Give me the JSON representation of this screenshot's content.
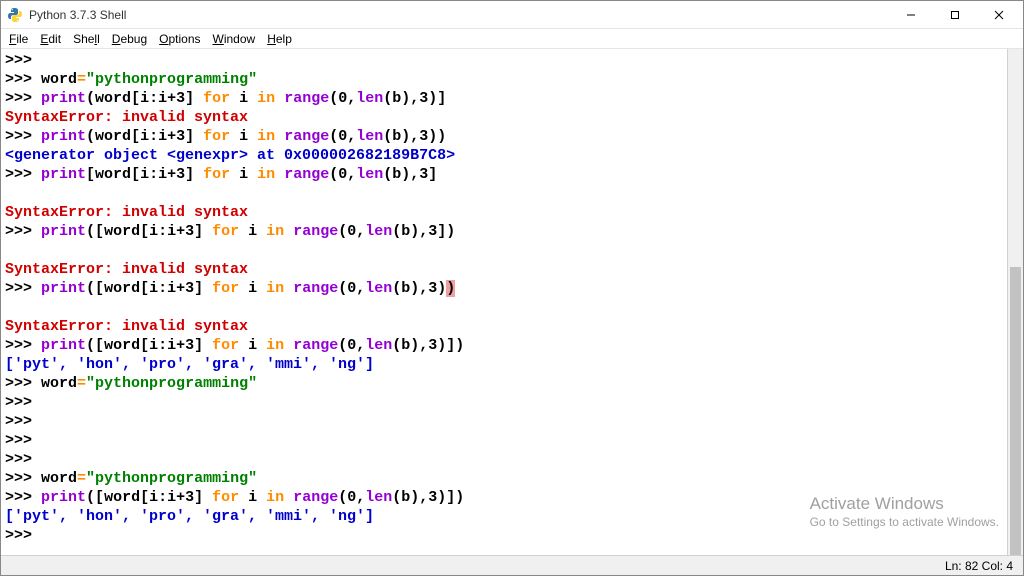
{
  "window": {
    "title": "Python 3.7.3 Shell"
  },
  "menu": {
    "items": [
      {
        "ul": "F",
        "rest": "ile"
      },
      {
        "ul": "E",
        "rest": "dit"
      },
      {
        "ul": "",
        "rest": "She",
        "ul2": "l",
        "rest2": "l"
      },
      {
        "ul": "D",
        "rest": "ebug"
      },
      {
        "ul": "O",
        "rest": "ptions"
      },
      {
        "ul": "W",
        "rest": "indow"
      },
      {
        "ul": "H",
        "rest": "elp"
      }
    ]
  },
  "activate": {
    "line1": "Activate Windows",
    "line2": "Go to Settings to activate Windows."
  },
  "status": {
    "text": "Ln: 82  Col: 4"
  },
  "code": {
    "prm": ">>> ",
    "empty": ">>>",
    "word_assign_lhs": "word",
    "eq": "=",
    "str_py": "\"pythonprogramming\"",
    "print": "print",
    "lpar": "(",
    "rpar": ")",
    "lbr": "[",
    "rbr": "]",
    "word": "word",
    "slice": "[i:i+3]",
    "sp": " ",
    "for": "for",
    "i": "i",
    "in": "in",
    "range": "range",
    "args": "(0,",
    "len": "len",
    "b": "(b)",
    "tail": ",3)",
    "tail_sq": ",3]",
    "tail_rpar_sq": ",3)]",
    "tail_rpar_rpar": ",3))",
    "err": "SyntaxError: invalid syntax",
    "gen_out": "<generator object <genexpr> at 0x000002682189B7C8>",
    "list_out": "['pyt', 'hon', 'pro', 'gra', 'mmi', 'ng']",
    "blank": ""
  }
}
